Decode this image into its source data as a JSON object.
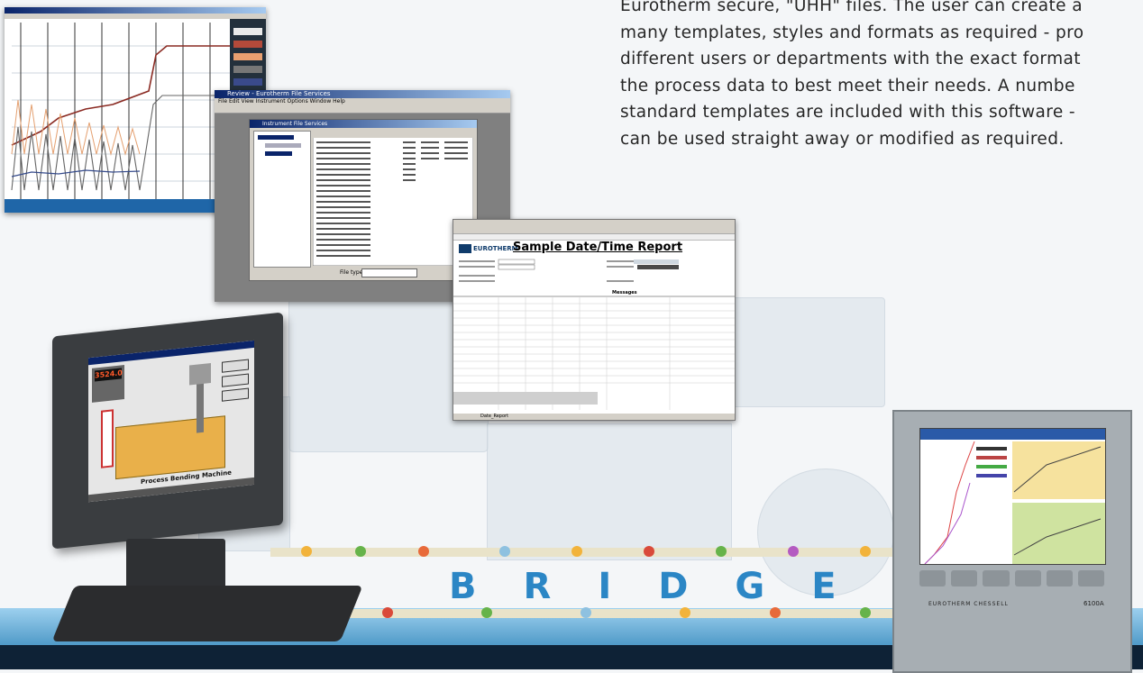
{
  "paragraph": {
    "lines": [
      "Eurotherm secure, \"UHH\" files. The user can create a",
      "many templates, styles and formats as required - pro",
      "different users or departments with the exact format",
      "the process data to best meet their needs.  A numbe",
      "standard templates are included with this software -",
      "can be used straight away or modified as required."
    ]
  },
  "file_services": {
    "title": "Review - Eurotherm File Services",
    "menu": "File  Edit  View  Instrument  Options  Window  Help",
    "subwindow_title": "Instrument File Services",
    "file_type_label": "File type:"
  },
  "report": {
    "logo": "EUROTHERM",
    "title": "Sample Date/Time Report",
    "messages_header": "Messages",
    "sheet_tabs": "Date_Report"
  },
  "touch_panel": {
    "readout": "3524.0",
    "caption": "Process Bending Machine"
  },
  "recorder": {
    "brand": "EUROTHERM CHESSELL",
    "model": "6100A"
  },
  "bridge": {
    "letters": [
      "B",
      "R",
      "I",
      "D",
      "G",
      "E"
    ]
  },
  "colors": {
    "accent_blue": "#2b86c5",
    "title_bar": "#0a246a"
  }
}
